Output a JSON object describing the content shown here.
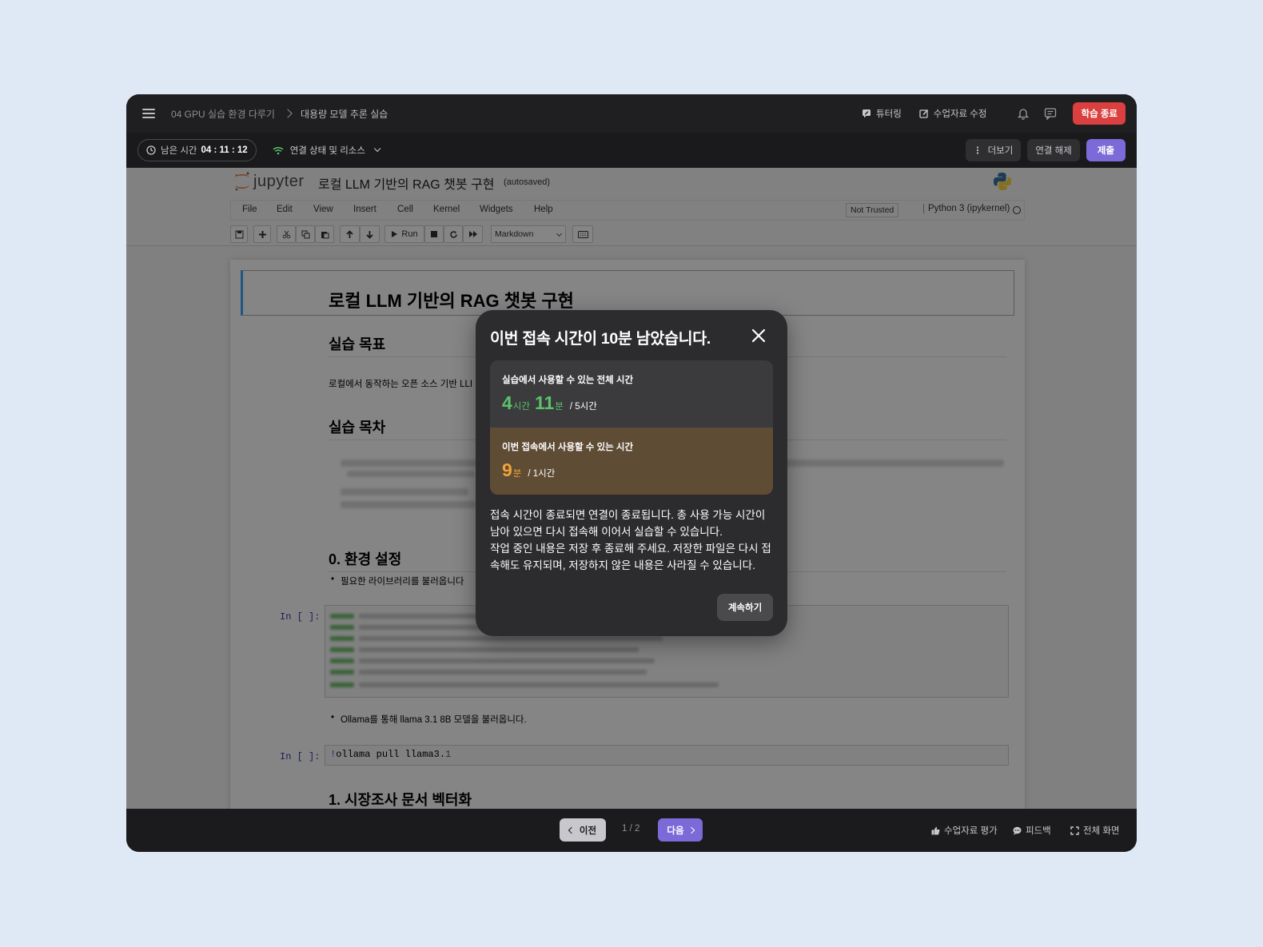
{
  "breadcrumb": {
    "course": "04 GPU 실습 환경 다루기",
    "lesson": "대용량 모델 추론 실습"
  },
  "top_actions": {
    "tutoring": "튜터링",
    "edit_material": "수업자료 수정",
    "end_study": "학습 종료"
  },
  "subbar": {
    "timer_label": "남은 시간",
    "timer_value": "04 : 11 : 12",
    "connection": "연결 상태 및 리소스",
    "more": "더보기",
    "disconnect": "연결 해제",
    "submit": "제출"
  },
  "jupyter": {
    "logo_text": "jupyter",
    "notebook_title": "로컬 LLM 기반의 RAG 챗봇 구현",
    "autosaved": "(autosaved)",
    "menu": [
      "File",
      "Edit",
      "View",
      "Insert",
      "Cell",
      "Kernel",
      "Widgets",
      "Help"
    ],
    "not_trusted": "Not Trusted",
    "kernel": "Python 3 (ipykernel)",
    "run_label": "Run",
    "cell_type": "Markdown"
  },
  "notebook": {
    "h1": "로컬 LLM 기반의 RAG 챗봇 구현",
    "goal_heading": "실습 목표",
    "goal_text": "로컬에서 동작하는 오픈 소스 기반 LLI",
    "toc_heading": "실습 목차",
    "env_heading": "0. 환경 설정",
    "env_bullet": "필요한 라이브러리를 불러옵니다",
    "prompt": "In [ ]:",
    "ollama_bullet": "Ollama를 통해 llama 3.1 8B 모델을 불러옵니다.",
    "code_bang": "!",
    "code_cmd": "ollama pull llama3.",
    "code_num": "1",
    "section1_heading": "1. 시장조사 문서 벡터화"
  },
  "footer": {
    "prev": "이전",
    "pager": "1 / 2",
    "next": "다음",
    "rate": "수업자료 평가",
    "feedback": "피드백",
    "fullscreen": "전체 화면"
  },
  "modal": {
    "title": "이번 접속 시간이 10분 남았습니다.",
    "total_label": "실습에서 사용할 수 있는 전체 시간",
    "total_hours": "4",
    "hours_unit": "시간",
    "total_minutes": "11",
    "minutes_unit": "분",
    "total_of": "/ 5시간",
    "session_label": "이번 접속에서 사용할 수 있는 시간",
    "session_minutes": "9",
    "session_of": "/ 1시간",
    "body_1": "접속 시간이 종료되면 연결이 종료됩니다. 총 사용 가능 시간이 남아 있으면 다시 접속해 이어서 실습할 수 있습니다.",
    "body_2": "작업 중인 내용은 저장 후 종료해 주세요. 저장한 파일은 다시 접속해도 유지되며, 저장하지 않은 내용은 사라질 수 있습니다.",
    "continue": "계속하기"
  },
  "colors": {
    "accent_purple": "#7c6ad8",
    "danger_red": "#d9403f",
    "time_green": "#5cc26a",
    "time_orange": "#f0a33a"
  }
}
